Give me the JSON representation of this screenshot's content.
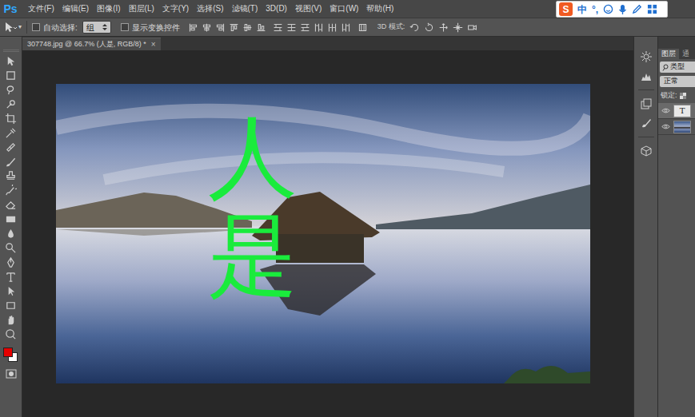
{
  "app": {
    "logo": "Ps"
  },
  "menu": [
    "文件(F)",
    "编辑(E)",
    "图像(I)",
    "图层(L)",
    "文字(Y)",
    "选择(S)",
    "滤镜(T)",
    "3D(D)",
    "视图(V)",
    "窗口(W)",
    "帮助(H)"
  ],
  "ime": {
    "logo": "S",
    "items": [
      "中",
      "°,"
    ]
  },
  "options": {
    "auto_select": {
      "label": "自动选择:",
      "checked": false
    },
    "auto_select_value": "组",
    "show_transform": {
      "label": "显示变换控件",
      "checked": false
    },
    "mode_3d": "3D 模式:"
  },
  "document_tab": {
    "title": "307748.jpg @ 66.7% (人是, RGB/8) *",
    "close": "×"
  },
  "canvas": {
    "text_layer": "人是"
  },
  "toolbar": {
    "foreground": "#e60000",
    "background": "#ffffff"
  },
  "panel": {
    "tabs": [
      {
        "label": "图层",
        "selected": true
      },
      {
        "label": "通",
        "selected": false
      }
    ],
    "filter": "类型",
    "blend_mode": "正常",
    "lock_label": "锁定:",
    "layers": [
      {
        "kind": "text",
        "thumb": "T",
        "visible": true,
        "selected": true
      },
      {
        "kind": "image",
        "visible": true,
        "selected": false
      }
    ]
  }
}
